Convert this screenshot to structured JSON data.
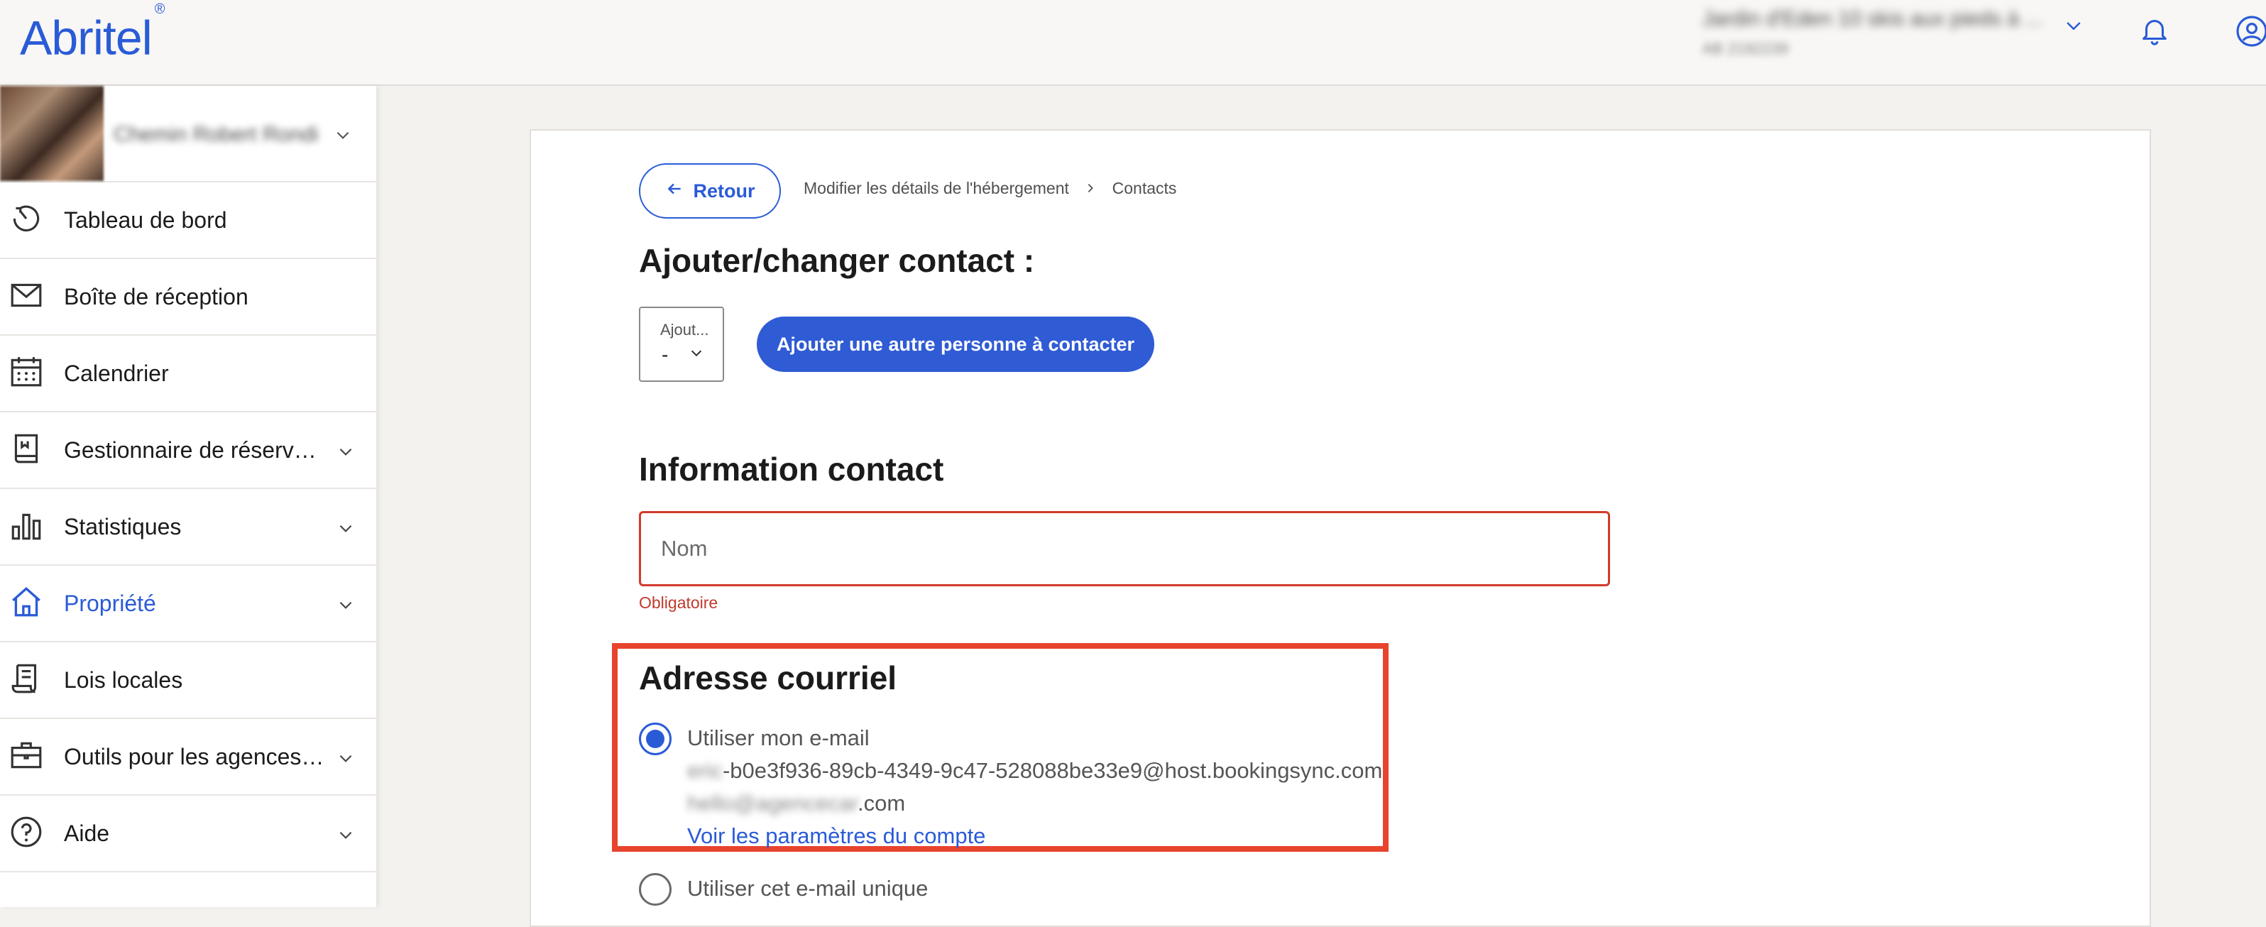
{
  "header": {
    "logo": "Abritel",
    "logo_mark": "®",
    "property_title": "Jardin d'Eden 10 skis aux pieds à ...",
    "property_id": "AB 2192239"
  },
  "sidebar": {
    "owner_name": "Chemin Robert Rondi",
    "items": [
      {
        "label": "Tableau de bord",
        "icon": "dashboard-icon",
        "expandable": false
      },
      {
        "label": "Boîte de réception",
        "icon": "mail-icon",
        "expandable": false
      },
      {
        "label": "Calendrier",
        "icon": "calendar-icon",
        "expandable": false
      },
      {
        "label": "Gestionnaire de réservations",
        "icon": "book-icon",
        "expandable": true
      },
      {
        "label": "Statistiques",
        "icon": "bar-chart-icon",
        "expandable": true
      },
      {
        "label": "Propriété",
        "icon": "house-icon",
        "expandable": true,
        "active": true
      },
      {
        "label": "Lois locales",
        "icon": "scroll-icon",
        "expandable": false
      },
      {
        "label": "Outils pour les agences immobilières",
        "icon": "briefcase-icon",
        "expandable": true
      },
      {
        "label": "Aide",
        "icon": "help-icon",
        "expandable": true
      }
    ]
  },
  "main": {
    "back_label": "Retour",
    "breadcrumb": [
      "Modifier les détails de l'hébergement",
      "Contacts"
    ],
    "add_heading": "Ajouter/changer contact :",
    "select_label": "Ajout...",
    "select_value": "-",
    "add_person_button": "Ajouter une autre personne à contacter",
    "info_heading": "Information contact",
    "name_placeholder": "Nom",
    "name_error": "Obligatoire",
    "email_heading": "Adresse courriel",
    "option_my_email": "Utiliser mon e-mail",
    "email_prefix_hidden": "eric",
    "email_primary_visible": "-b0e3f936-89cb-4349-9c47-528088be33e9@host.bookingsync.com",
    "email_secondary_hidden": "hello@agencecar",
    "email_secondary_visible": ".com",
    "account_settings_link": "Voir les paramètres du compte",
    "option_unique_email": "Utiliser cet e-mail unique"
  },
  "colors": {
    "brand": "#2a5bd7",
    "error": "#d13b2b",
    "highlight": "#e8432d"
  }
}
